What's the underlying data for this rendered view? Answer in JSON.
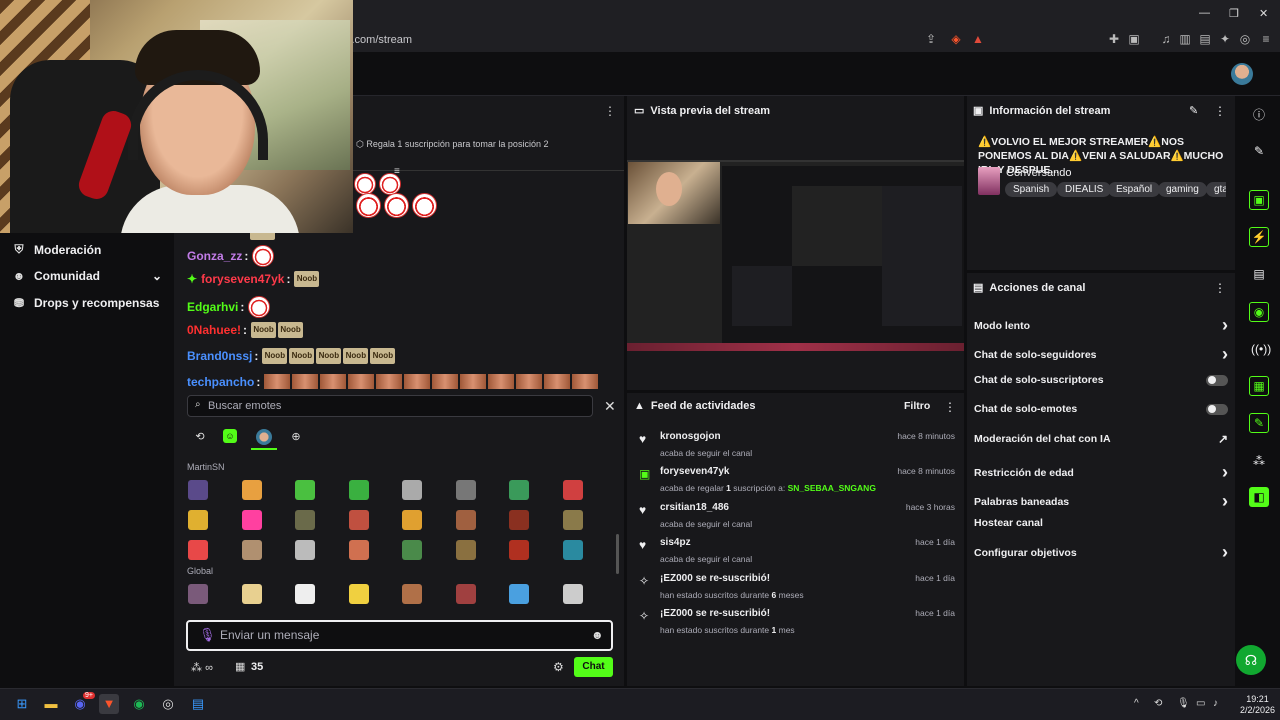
{
  "browser": {
    "url": "k.com/stream",
    "window_controls": {
      "minimize": "—",
      "maximize": "❐",
      "close": "✕"
    }
  },
  "nav": {
    "items": [
      {
        "label": "Moderación",
        "icon": "shield-icon"
      },
      {
        "label": "Comunidad",
        "icon": "people-icon"
      },
      {
        "label": "Drops y recompensas",
        "icon": "gift-icon"
      }
    ]
  },
  "chat": {
    "gift_notice": "Regala 1 suscripción para tomar la posición 2",
    "messages": [
      {
        "user": "Gonza_zz",
        "color": "#c27ce8",
        "emotes": [
          "clown"
        ]
      },
      {
        "user": "foryseven47yk",
        "color": "#ff3a4a",
        "emotes": [
          "noob"
        ]
      },
      {
        "user": "Edgarhvi",
        "color": "#53fc18",
        "emotes": [
          "clown"
        ]
      },
      {
        "user": "0Nahuee!",
        "color": "#ff3030",
        "emotes": [
          "noob",
          "noob"
        ]
      },
      {
        "user": "Brand0nssj",
        "color": "#4a90ff",
        "emotes": [
          "noob",
          "noob",
          "noob",
          "noob",
          "noob"
        ]
      },
      {
        "user": "techpancho",
        "color": "#4a90ff",
        "emotes": [
          "face",
          "face",
          "face",
          "face",
          "face",
          "face",
          "face",
          "face",
          "face",
          "face",
          "face",
          "face"
        ]
      }
    ],
    "emote_noob_label": "Noob",
    "emote_search_placeholder": "Buscar emotes",
    "emote_section_channel": "MartinSN",
    "emote_section_global": "Global",
    "input_placeholder": "Enviar un mensaje",
    "points_symbol": "∞",
    "shop_count": "35",
    "send_label": "Chat"
  },
  "preview": {
    "title": "Vista previa del stream"
  },
  "feed": {
    "title": "Feed de actividades",
    "filter_label": "Filtro",
    "items": [
      {
        "icon": "heart-icon",
        "user": "kronosgojon",
        "pre": "acaba de seguir el canal",
        "bold": "",
        "mid": "",
        "green": "",
        "post": "",
        "time": "hace 8 minutos"
      },
      {
        "icon": "gift-icon",
        "user": "foryseven47yk",
        "pre": "acaba de regalar ",
        "bold": "1",
        "mid": " suscripción a: ",
        "green": "SN_SEBAA_SNGANG",
        "post": "",
        "time": "hace 8 minutos"
      },
      {
        "icon": "heart-icon",
        "user": "crsitian18_486",
        "pre": "acaba de seguir el canal",
        "bold": "",
        "mid": "",
        "green": "",
        "post": "",
        "time": "hace 3 horas"
      },
      {
        "icon": "heart-icon",
        "user": "sis4pz",
        "pre": "acaba de seguir el canal",
        "bold": "",
        "mid": "",
        "green": "",
        "post": "",
        "time": "hace 1 día"
      },
      {
        "icon": "star-icon",
        "user": "¡EZ000 se re-suscribió!",
        "pre": "han estado suscritos durante ",
        "bold": "6",
        "mid": " meses",
        "green": "",
        "post": "",
        "time": "hace 1 día"
      },
      {
        "icon": "star-icon",
        "user": "¡EZ000 se re-suscribió!",
        "pre": "han estado suscritos durante ",
        "bold": "1",
        "mid": " mes",
        "green": "",
        "post": "",
        "time": "hace 1 día"
      }
    ]
  },
  "info": {
    "title": "Información del stream",
    "stream_title": "⚠️VOLVIO EL MEJOR STREAMER⚠️NOS PONEMOS AL DIA⚠️VENI A SALUDAR⚠️MUCHO IRL Y DESPUE...",
    "category": "Conversando",
    "tags": [
      "Spanish",
      "DIEALIS",
      "Español",
      "gaming",
      "gta"
    ]
  },
  "actions": {
    "title": "Acciones de canal",
    "rows": [
      {
        "label": "Modo lento",
        "control": "chevron"
      },
      {
        "label": "Chat de solo-seguidores",
        "control": "chevron"
      },
      {
        "label": "Chat de solo-suscriptores",
        "control": "toggle"
      },
      {
        "label": "Chat de solo-emotes",
        "control": "toggle"
      },
      {
        "label": "Moderación del chat con IA",
        "control": "external"
      },
      {
        "label": "Restricción de edad",
        "control": "chevron"
      },
      {
        "label": "Palabras baneadas",
        "control": "chevron"
      },
      {
        "label": "Hostear canal",
        "control": "none"
      },
      {
        "label": "Configurar objetivos",
        "control": "chevron"
      }
    ]
  },
  "taskbar": {
    "time": "19:21",
    "date": "2/2/2026",
    "discord_badge": "9+"
  }
}
